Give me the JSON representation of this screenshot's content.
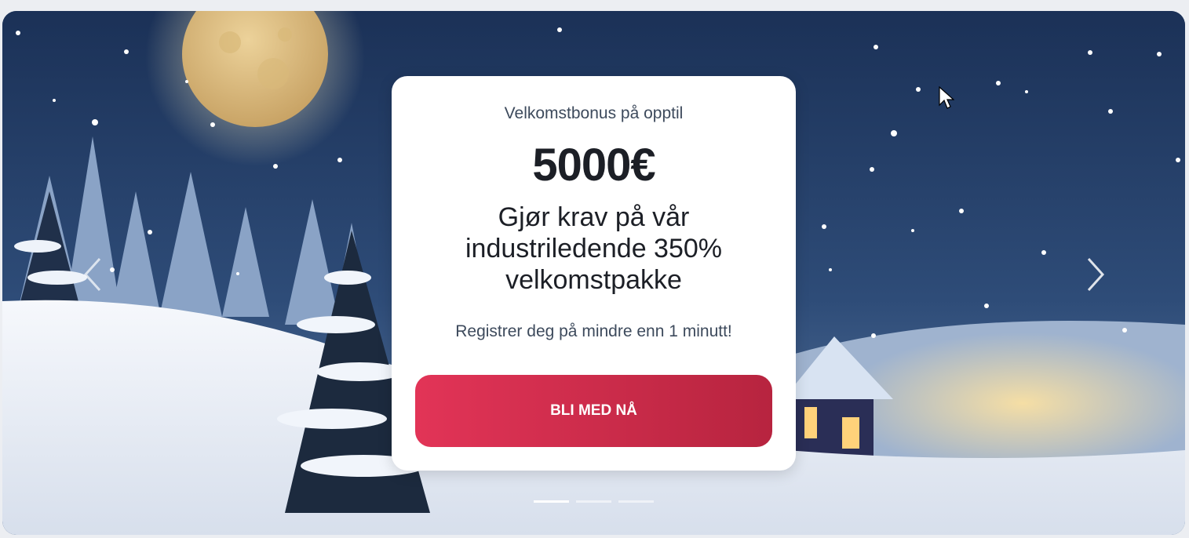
{
  "banner": {
    "subtitle": "Velkomstbonus på opptil",
    "amount": "5000€",
    "headline": "Gjør krav på vår industriledende 350% velkomstpakke",
    "note": "Registrer deg på mindre enn 1 minutt!",
    "cta_label": "BLI MED NÅ"
  },
  "carousel": {
    "slide_count": 3,
    "active_index": 0,
    "prev_icon": "chevron-left-icon",
    "next_icon": "chevron-right-icon"
  },
  "colors": {
    "sky": "#1d3a62",
    "cta_start": "#e23457",
    "cta_end": "#b7243f",
    "card": "#ffffff",
    "page_bg": "#eceef2"
  }
}
